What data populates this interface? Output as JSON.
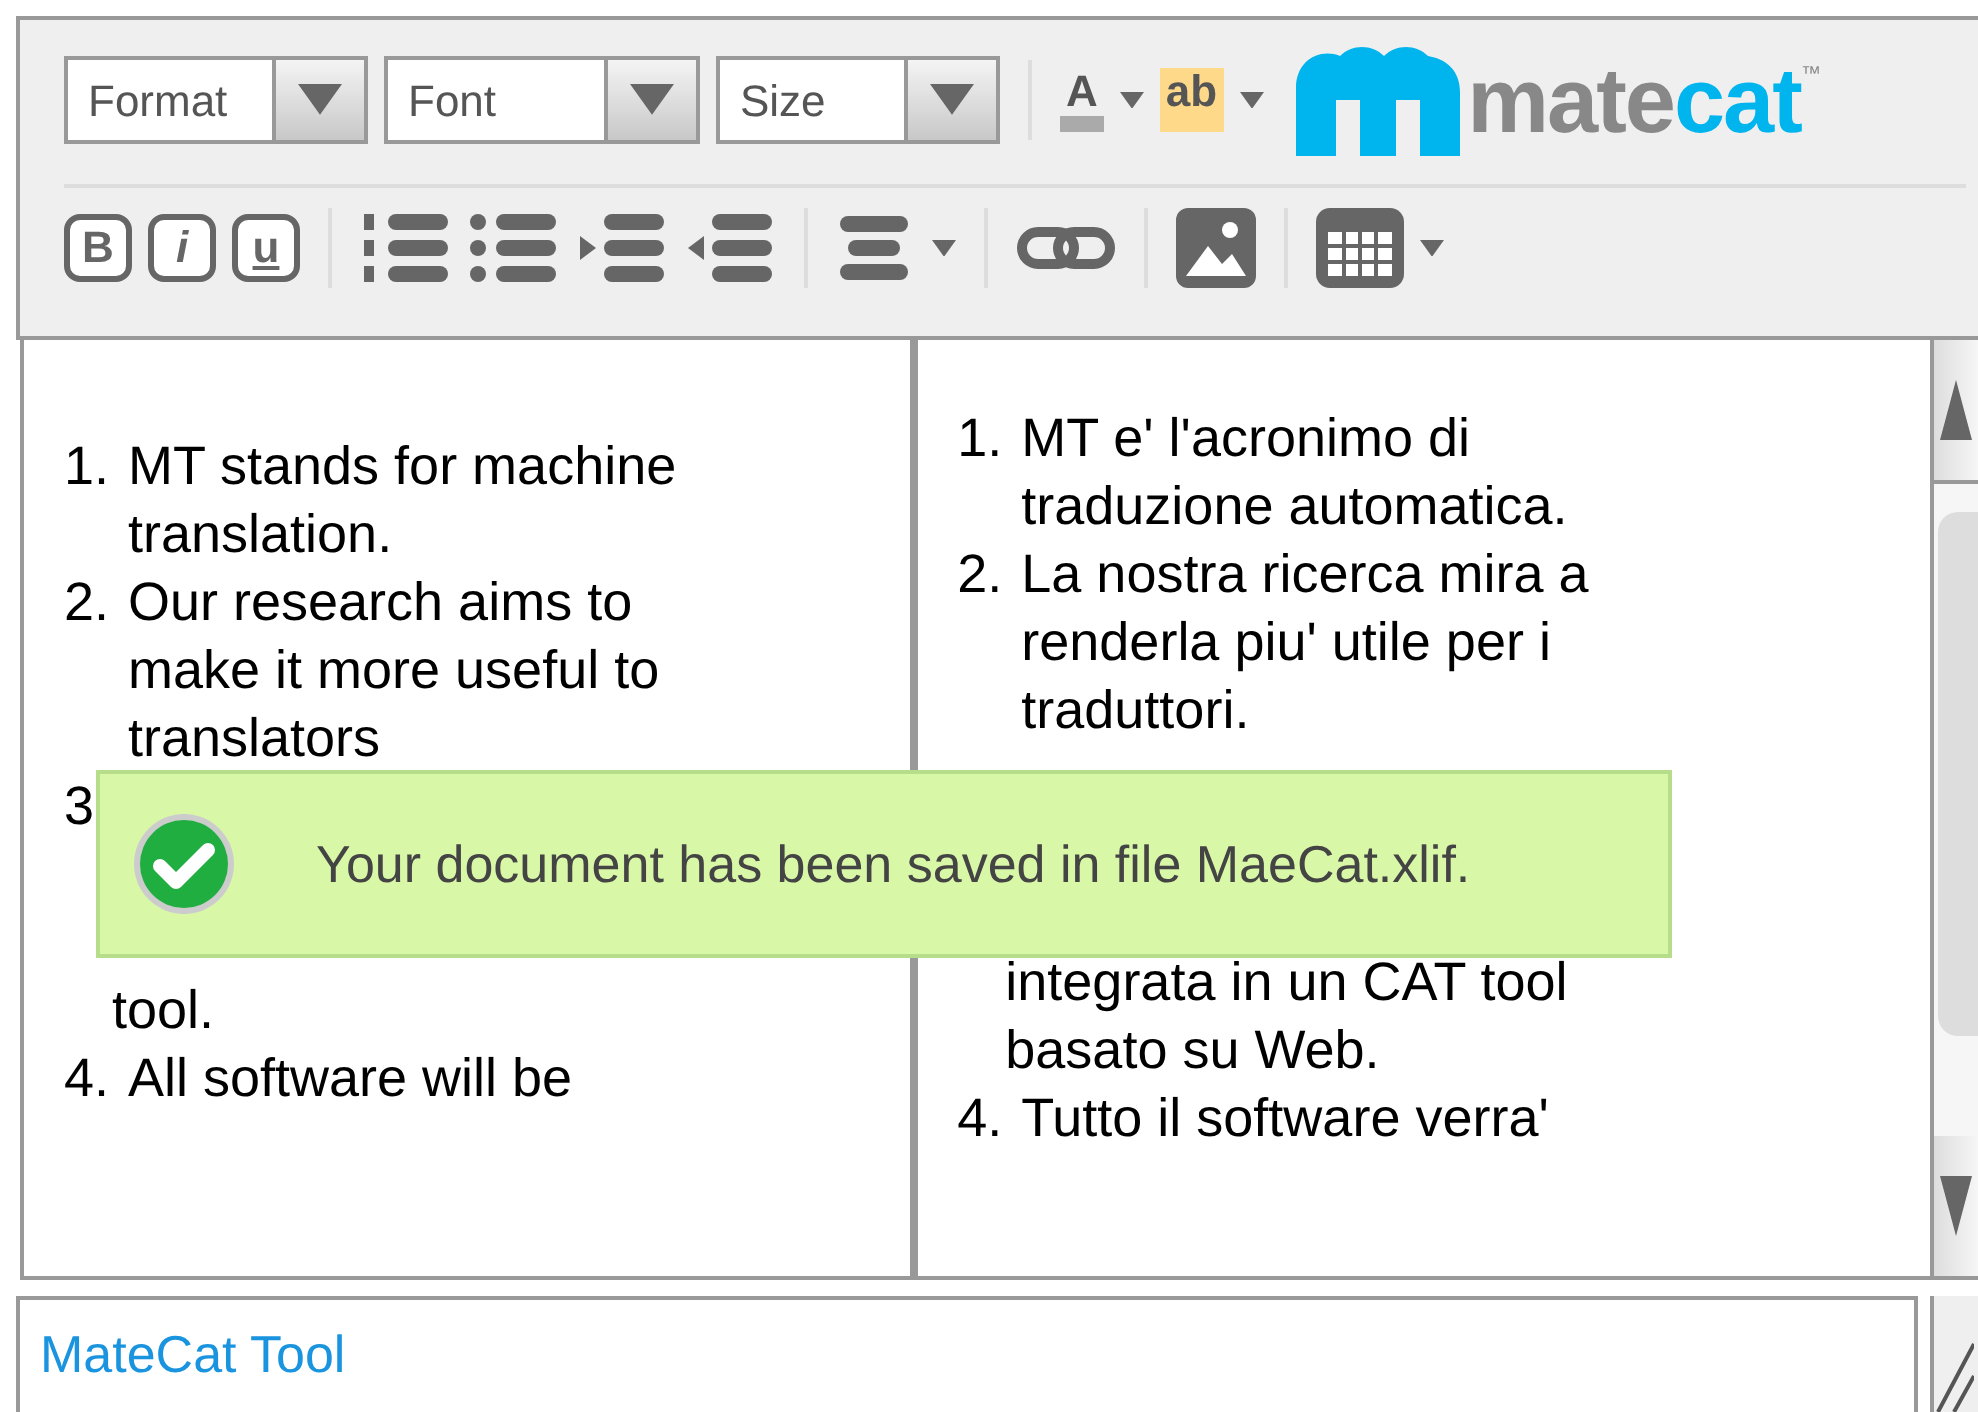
{
  "toolbar": {
    "dropdowns": [
      {
        "label": "Format"
      },
      {
        "label": "Font"
      },
      {
        "label": "Size"
      }
    ],
    "text_color": {
      "glyph": "A"
    },
    "highlight": {
      "glyph": "ab"
    },
    "styles": [
      {
        "glyph": "B",
        "kind": "bold"
      },
      {
        "glyph": "i",
        "kind": "italic"
      },
      {
        "glyph": "u",
        "kind": "underline"
      }
    ],
    "logo": {
      "brand_a": "mate",
      "brand_b": "cat",
      "mark": "™"
    }
  },
  "source": {
    "items": [
      {
        "number": "1.",
        "lines": [
          "MT stands for machine",
          "translation."
        ]
      },
      {
        "number": "2.",
        "lines": [
          "Our research aims to",
          "make it more useful to",
          "translators"
        ]
      },
      {
        "number": "3",
        "lines": [
          "tool."
        ],
        "covered": true
      },
      {
        "number": "4.",
        "lines": [
          "All software will be"
        ]
      }
    ]
  },
  "target": {
    "items": [
      {
        "number": "1.",
        "lines": [
          "MT e' l'acronimo di",
          "traduzione automatica."
        ]
      },
      {
        "number": "2.",
        "lines": [
          "La nostra ricerca mira a",
          "renderla piu' utile per i",
          "traduttori."
        ]
      },
      {
        "lines": [
          "integrata in un CAT tool",
          "basato su Web."
        ],
        "covered": true
      },
      {
        "number": "4.",
        "lines": [
          "Tutto il software verra'"
        ]
      }
    ]
  },
  "toast": {
    "message": "Your document has been saved in file MaeCat.xlif."
  },
  "footer": {
    "link": "MateCat Tool"
  }
}
